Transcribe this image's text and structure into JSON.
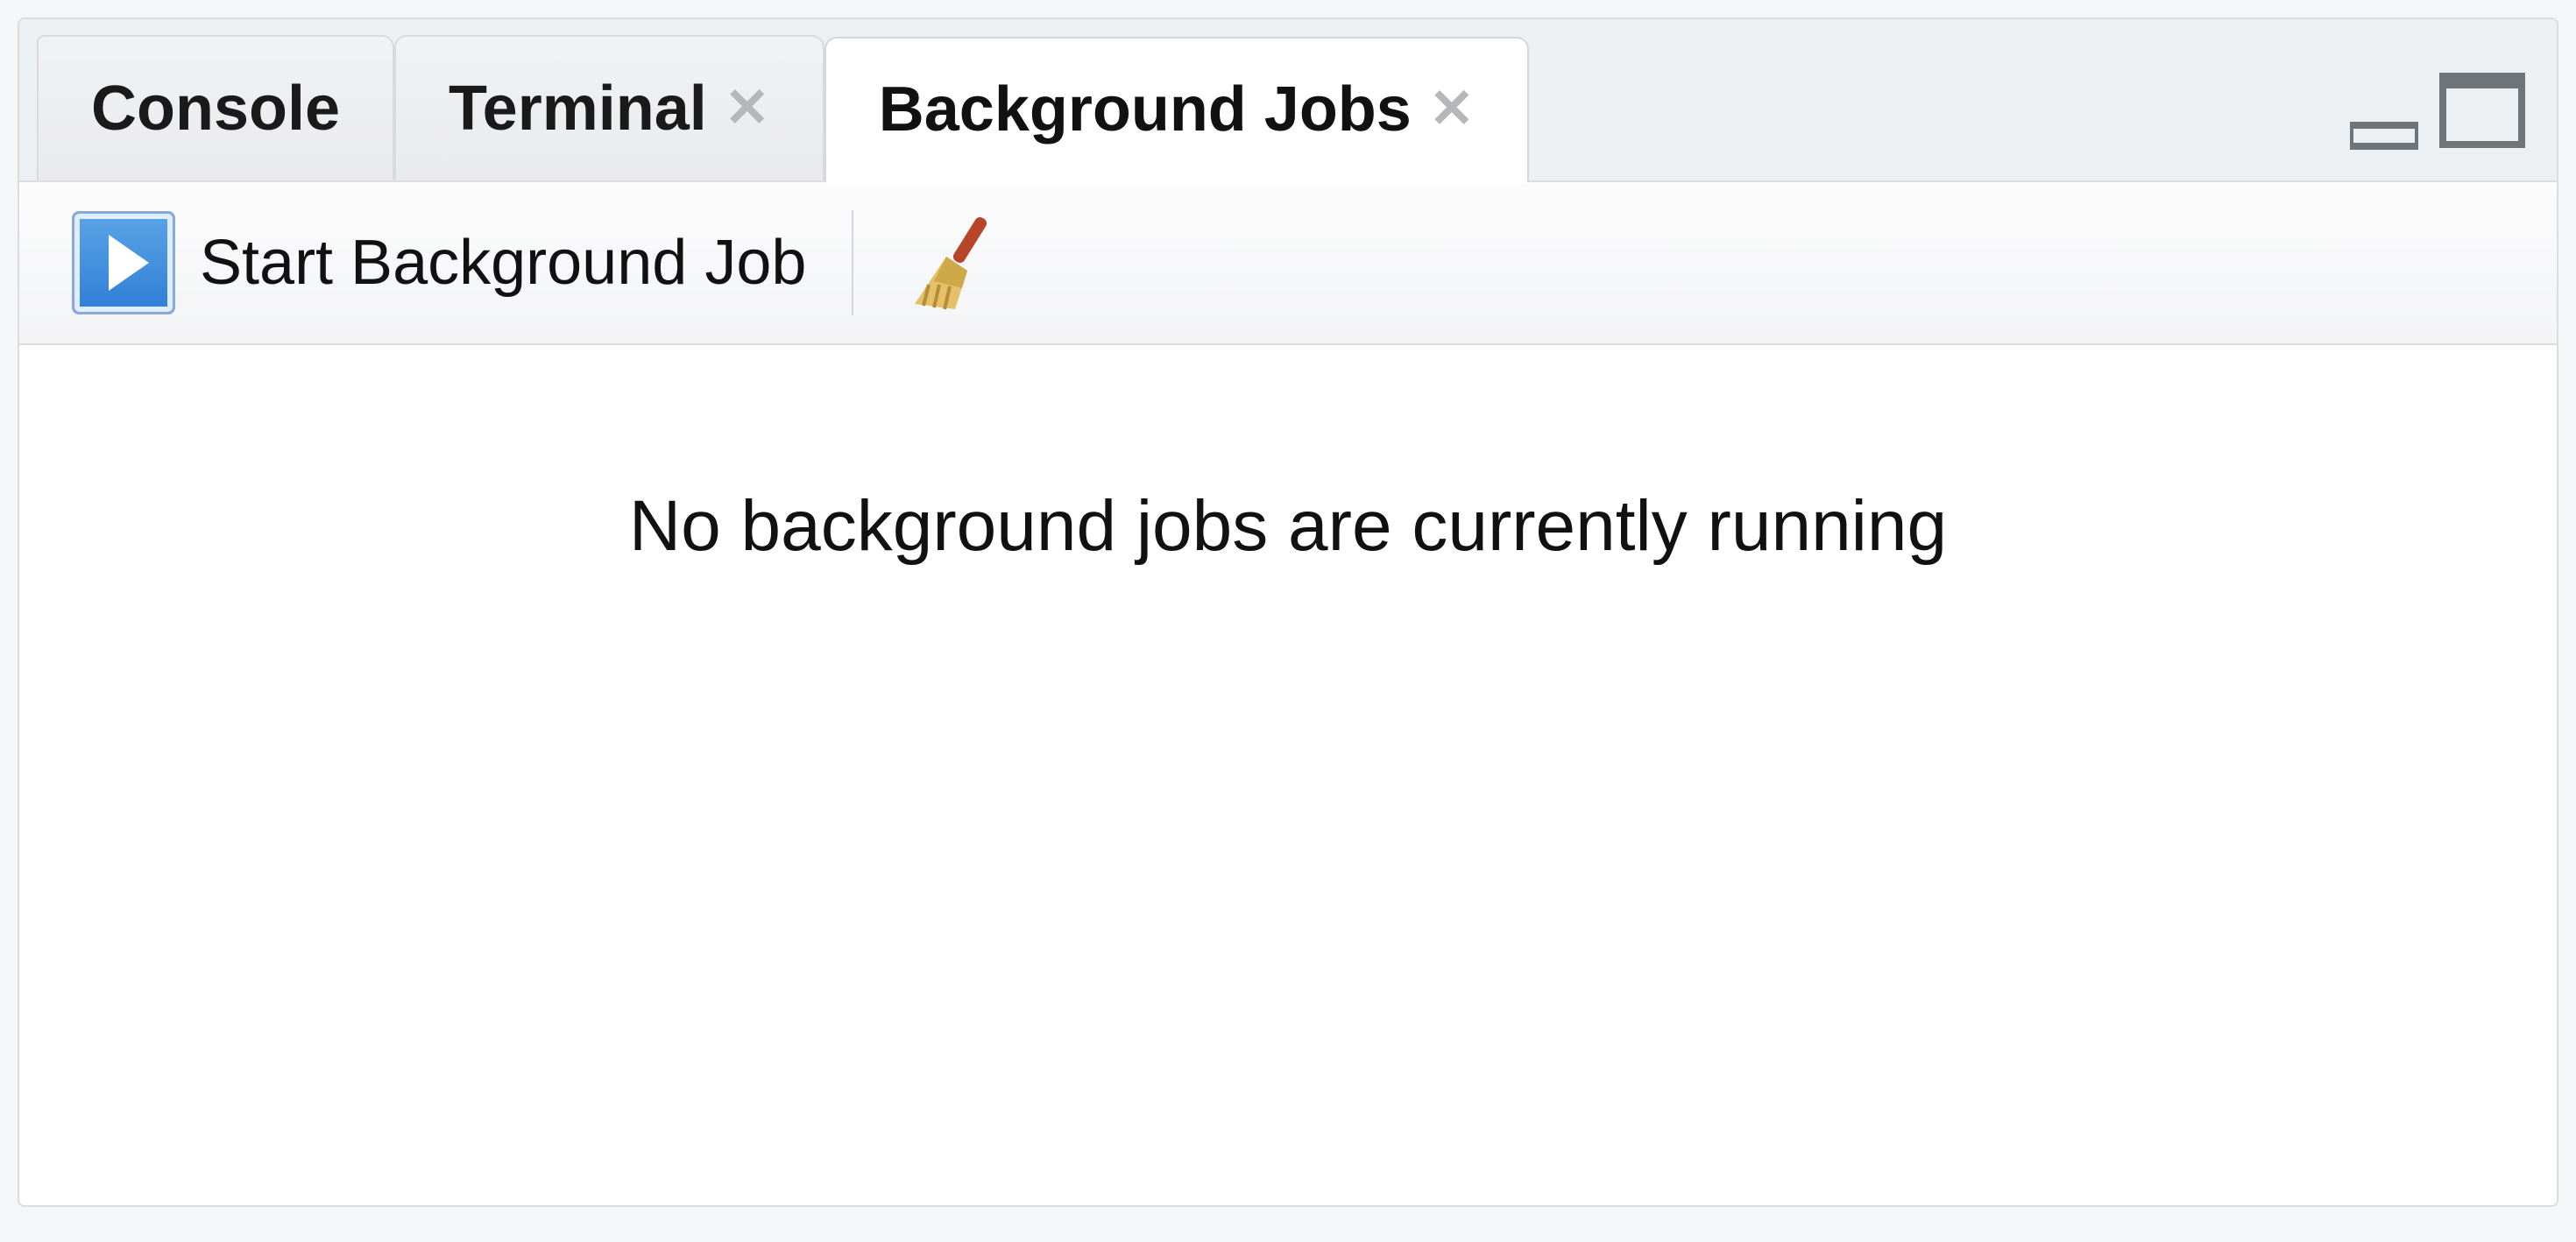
{
  "tabs": {
    "console": {
      "label": "Console"
    },
    "terminal": {
      "label": "Terminal"
    },
    "bgjobs": {
      "label": "Background Jobs"
    }
  },
  "toolbar": {
    "start_label": "Start Background Job"
  },
  "content": {
    "empty_message": "No background jobs are currently running"
  }
}
